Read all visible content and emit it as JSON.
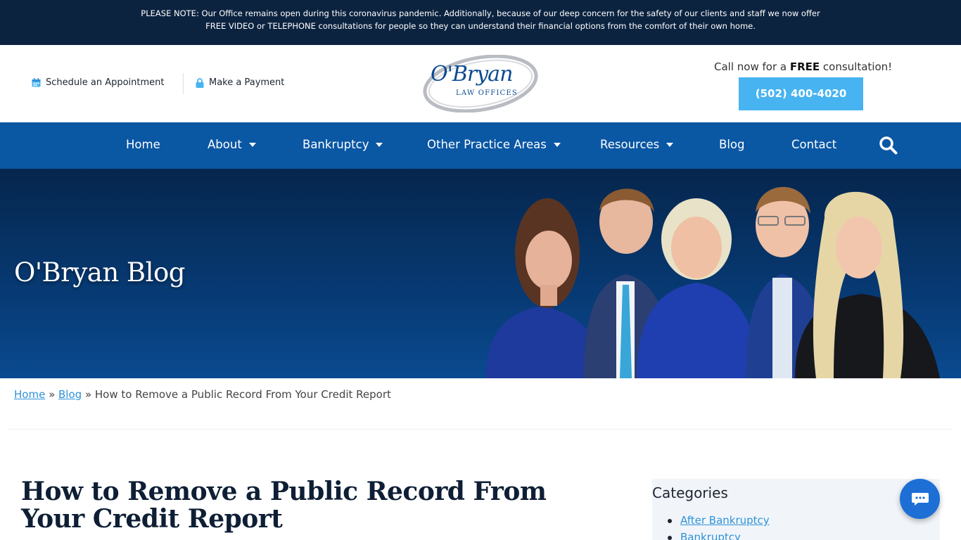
{
  "notice": {
    "line1": "PLEASE NOTE: Our Office remains open during this coronavirus pandemic. Additionally, because of our deep concern for the safety of our clients and staff we now offer",
    "line2": "FREE VIDEO or TELEPHONE consultations for people so they can understand their financial options from the comfort of their own home."
  },
  "header": {
    "appointment_label": "Schedule an Appointment",
    "payment_label": "Make a Payment",
    "logo_text": "O'Bryan",
    "logo_sub": "LAW OFFICES",
    "cta_prefix": "Call now for a ",
    "cta_bold": "FREE",
    "cta_suffix": " consultation!",
    "phone": "(502) 400-4020"
  },
  "nav": {
    "items": [
      {
        "label": "Home"
      },
      {
        "label": "About"
      },
      {
        "label": "Bankruptcy"
      },
      {
        "label": "Other Practice Areas"
      },
      {
        "label": "Resources"
      },
      {
        "label": "Blog"
      },
      {
        "label": "Contact"
      }
    ]
  },
  "hero": {
    "title": "O'Bryan Blog"
  },
  "breadcrumb": {
    "home": "Home",
    "sep1": " » ",
    "blog": "Blog",
    "sep2": " » ",
    "current": "How to Remove a Public Record From Your Credit Report"
  },
  "post": {
    "title": "How to Remove a Public Record From Your Credit Report"
  },
  "sidebar": {
    "title": "Categories",
    "categories": [
      "After Bankruptcy",
      "Bankruptcy"
    ]
  },
  "colors": {
    "notice_bg": "#0c2340",
    "nav_bg": "#0a57a4",
    "accent": "#47b4f1",
    "link": "#2f92d8",
    "chat": "#1d6fd6"
  },
  "icons": {
    "appointment": "calendar-icon",
    "payment": "lock-icon",
    "search": "search-icon",
    "chat": "chat-icon"
  }
}
